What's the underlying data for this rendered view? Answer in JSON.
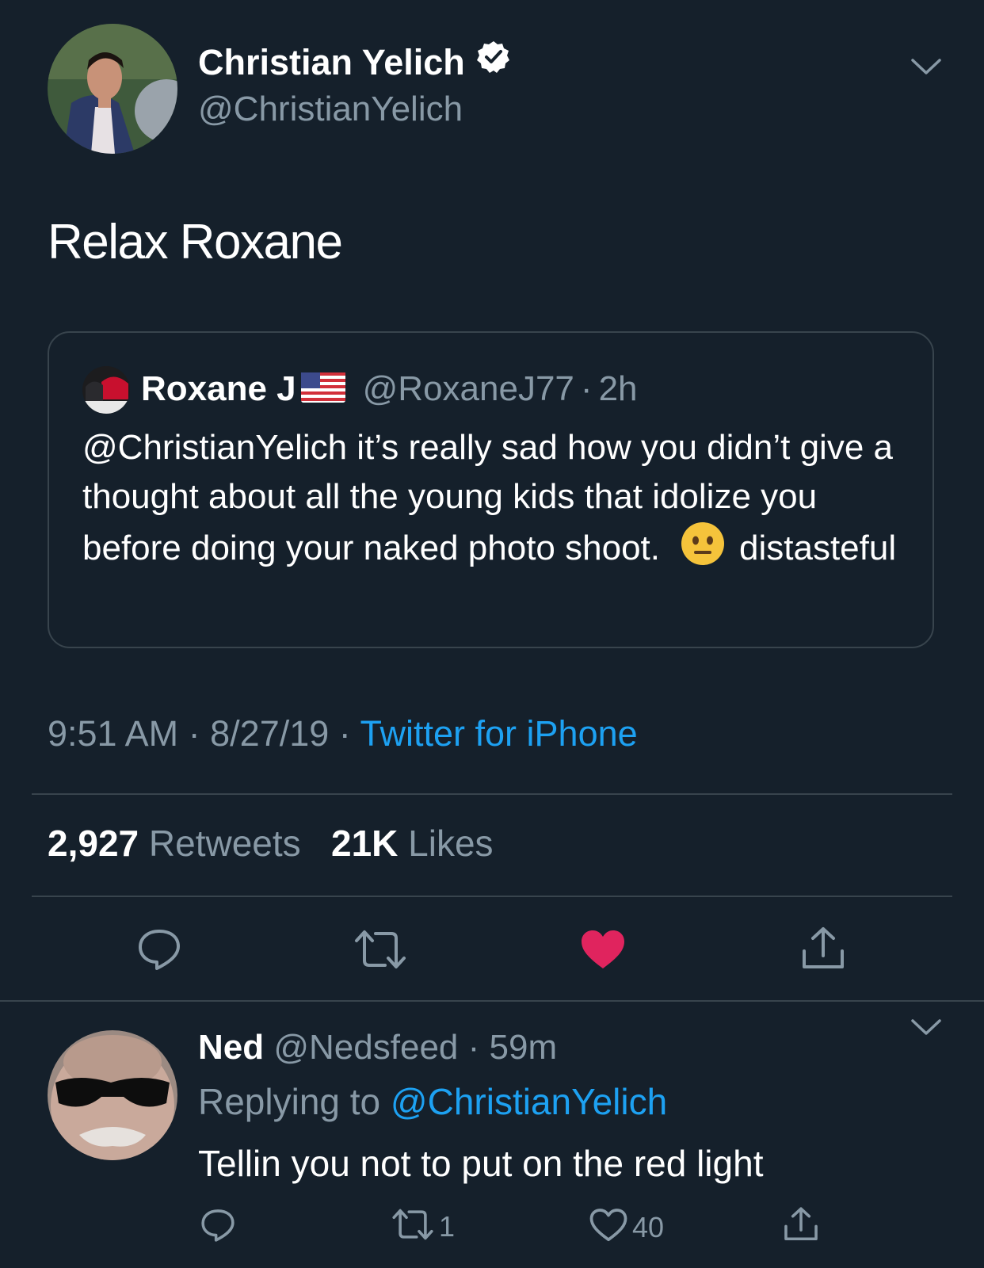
{
  "tweet": {
    "author": {
      "name": "Christian Yelich",
      "handle": "@ChristianYelich",
      "verified": true
    },
    "text": "Relax Roxane",
    "quoted": {
      "name": "Roxane J",
      "flag_icon": "us-flag-icon",
      "handle": "@RoxaneJ77",
      "separator": "·",
      "time": "2h",
      "text_main": "@ChristianYelich it’s really sad how you didn’t give a thought about all the young kids that idolize you before doing your naked photo shoot.",
      "emoji": "neutral-face-emoji",
      "text_end": "distasteful"
    },
    "meta": {
      "time": "9:51 AM",
      "sep1": "·",
      "date": "8/27/19",
      "sep2": "·",
      "source": "Twitter for iPhone"
    },
    "stats": {
      "retweets_count": "2,927",
      "retweets_label": "Retweets",
      "likes_count": "21K",
      "likes_label": "Likes"
    },
    "actions": {
      "liked": true,
      "icons": [
        "reply-icon",
        "retweet-icon",
        "like-icon",
        "share-icon"
      ]
    }
  },
  "reply": {
    "name": "Ned",
    "handle": "@Nedsfeed",
    "separator": "·",
    "time": "59m",
    "replying_label": "Replying to",
    "replying_to": "@ChristianYelich",
    "text": "Tellin you not to put on the red light",
    "retweet_count": "1",
    "like_count": "40"
  },
  "colors": {
    "background": "#15202b",
    "secondary_text": "#8899a6",
    "link": "#1da1f2",
    "like": "#e0245e",
    "border": "#38444d"
  }
}
